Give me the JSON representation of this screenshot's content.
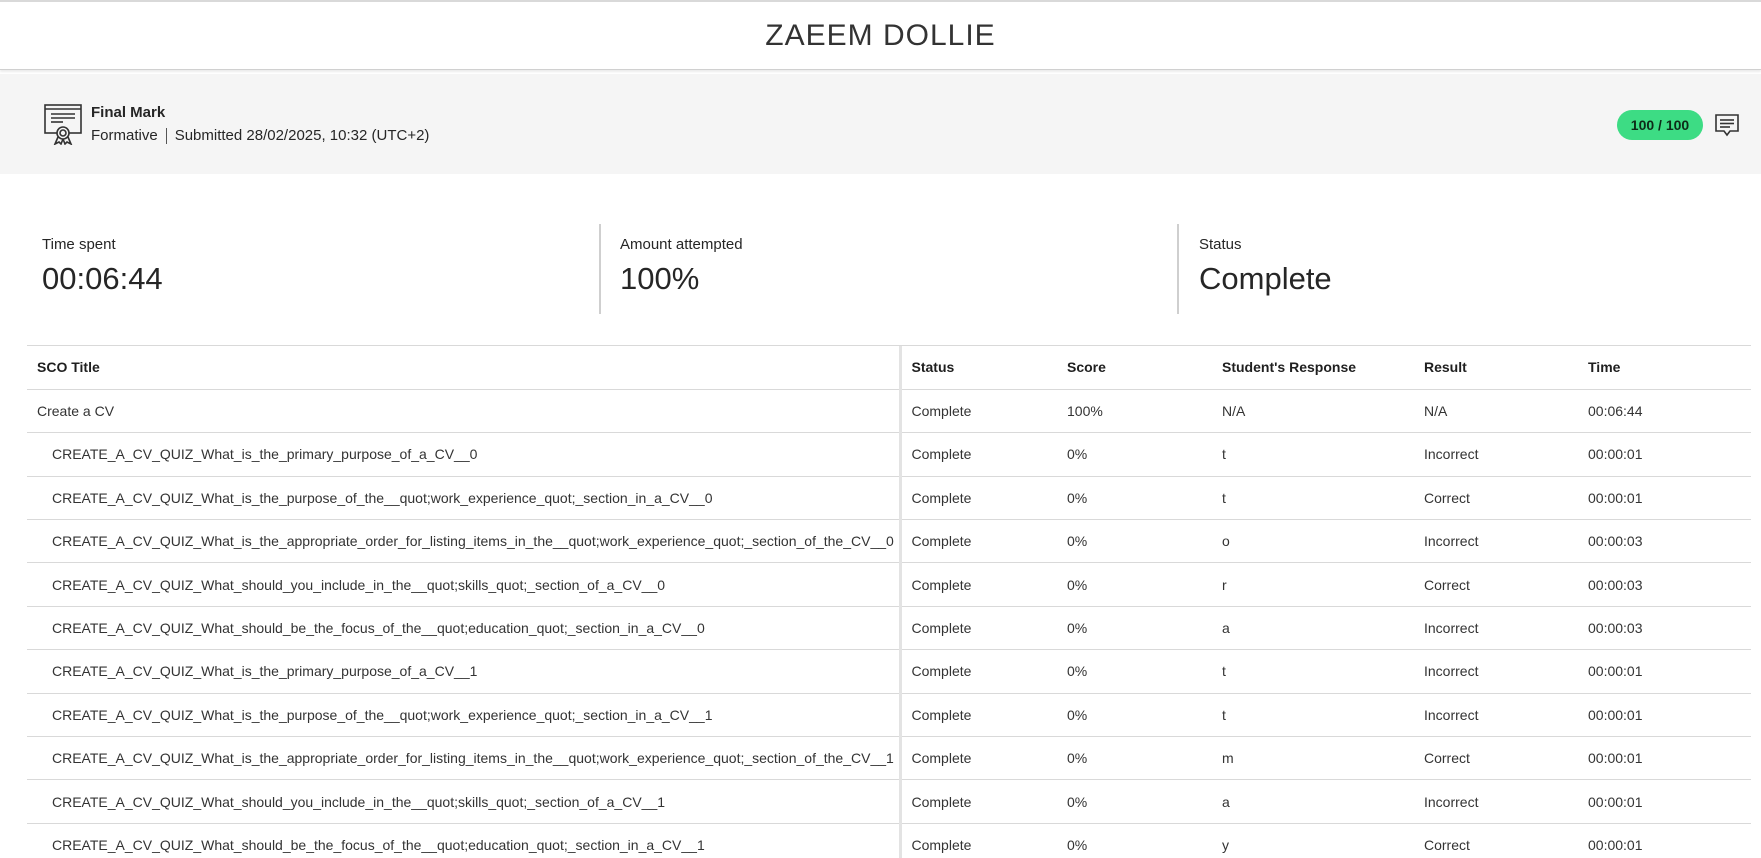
{
  "student": {
    "name": "ZAEEM DOLLIE"
  },
  "mark": {
    "icon": "certificate-icon",
    "title": "Final Mark",
    "type": "Formative",
    "submitted": "Submitted 28/02/2025, 10:32 (UTC+2)",
    "score": "100 / 100",
    "score_color": "#3ddc84",
    "comment_icon": "comment-icon"
  },
  "stats": {
    "time_spent": {
      "label": "Time spent",
      "value": "00:06:44"
    },
    "amount_attempted": {
      "label": "Amount attempted",
      "value": "100%"
    },
    "status": {
      "label": "Status",
      "value": "Complete"
    }
  },
  "table": {
    "headers": [
      "SCO Title",
      "Status",
      "Score",
      "Student's Response",
      "Result",
      "Time"
    ],
    "rows": [
      [
        "Create a CV",
        "Complete",
        "100%",
        "N/A",
        "N/A",
        "00:06:44"
      ],
      [
        "CREATE_A_CV_QUIZ_What_is_the_primary_purpose_of_a_CV__0",
        "Complete",
        "0%",
        "t",
        "Incorrect",
        "00:00:01"
      ],
      [
        "CREATE_A_CV_QUIZ_What_is_the_purpose_of_the__quot;work_experience_quot;_section_in_a_CV__0",
        "Complete",
        "0%",
        "t",
        "Correct",
        "00:00:01"
      ],
      [
        "CREATE_A_CV_QUIZ_What_is_the_appropriate_order_for_listing_items_in_the__quot;work_experience_quot;_section_of_the_CV__0",
        "Complete",
        "0%",
        "o",
        "Incorrect",
        "00:00:03"
      ],
      [
        "CREATE_A_CV_QUIZ_What_should_you_include_in_the__quot;skills_quot;_section_of_a_CV__0",
        "Complete",
        "0%",
        "r",
        "Correct",
        "00:00:03"
      ],
      [
        "CREATE_A_CV_QUIZ_What_should_be_the_focus_of_the__quot;education_quot;_section_in_a_CV__0",
        "Complete",
        "0%",
        "a",
        "Incorrect",
        "00:00:03"
      ],
      [
        "CREATE_A_CV_QUIZ_What_is_the_primary_purpose_of_a_CV__1",
        "Complete",
        "0%",
        "t",
        "Incorrect",
        "00:00:01"
      ],
      [
        "CREATE_A_CV_QUIZ_What_is_the_purpose_of_the__quot;work_experience_quot;_section_in_a_CV__1",
        "Complete",
        "0%",
        "t",
        "Incorrect",
        "00:00:01"
      ],
      [
        "CREATE_A_CV_QUIZ_What_is_the_appropriate_order_for_listing_items_in_the__quot;work_experience_quot;_section_of_the_CV__1",
        "Complete",
        "0%",
        "m",
        "Correct",
        "00:00:01"
      ],
      [
        "CREATE_A_CV_QUIZ_What_should_you_include_in_the__quot;skills_quot;_section_of_a_CV__1",
        "Complete",
        "0%",
        "a",
        "Incorrect",
        "00:00:01"
      ],
      [
        "CREATE_A_CV_QUIZ_What_should_be_the_focus_of_the__quot;education_quot;_section_in_a_CV__1",
        "Complete",
        "0%",
        "y",
        "Correct",
        "00:00:01"
      ]
    ]
  }
}
